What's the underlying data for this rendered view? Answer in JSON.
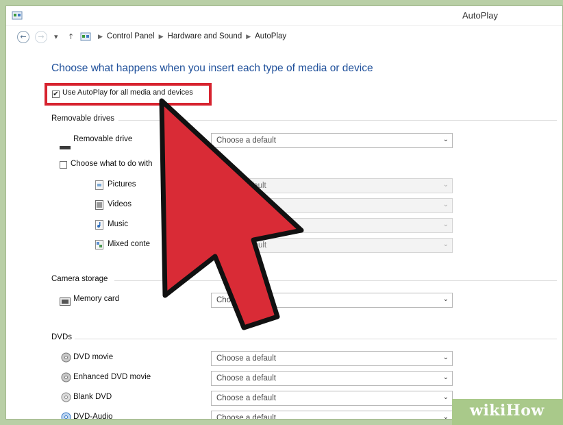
{
  "window": {
    "title": "AutoPlay"
  },
  "breadcrumb": [
    "Control Panel",
    "Hardware and Sound",
    "AutoPlay"
  ],
  "main": {
    "heading": "Choose what happens when you insert each type of media or device",
    "use_autoplay_label": "Use AutoPlay for all media and devices",
    "use_autoplay_checked": true
  },
  "removable": {
    "section": "Removable drives",
    "drive_label": "Removable drive",
    "drive_value": "Choose a default",
    "each_type_label": "Choose what to do with",
    "each_type_checked": false,
    "types": [
      {
        "label": "Pictures",
        "value": "fault"
      },
      {
        "label": "Videos",
        "value": ""
      },
      {
        "label": "Music",
        "value": ""
      },
      {
        "label": "Mixed conte",
        "value": "efault"
      }
    ]
  },
  "camera": {
    "section": "Camera storage",
    "memory_label": "Memory card",
    "memory_value": "Cho"
  },
  "dvds": {
    "section": "DVDs",
    "items": [
      {
        "label": "DVD movie",
        "value": "Choose a default"
      },
      {
        "label": "Enhanced DVD movie",
        "value": "Choose a default"
      },
      {
        "label": "Blank DVD",
        "value": "Choose a default"
      },
      {
        "label": "DVD-Audio",
        "value": "Choose a default"
      }
    ]
  },
  "watermark": {
    "part1": "wiki",
    "part2": "How"
  },
  "colors": {
    "heading": "#1e4f9a",
    "highlight": "#d7232f",
    "arrow_fill": "#d92b36"
  }
}
